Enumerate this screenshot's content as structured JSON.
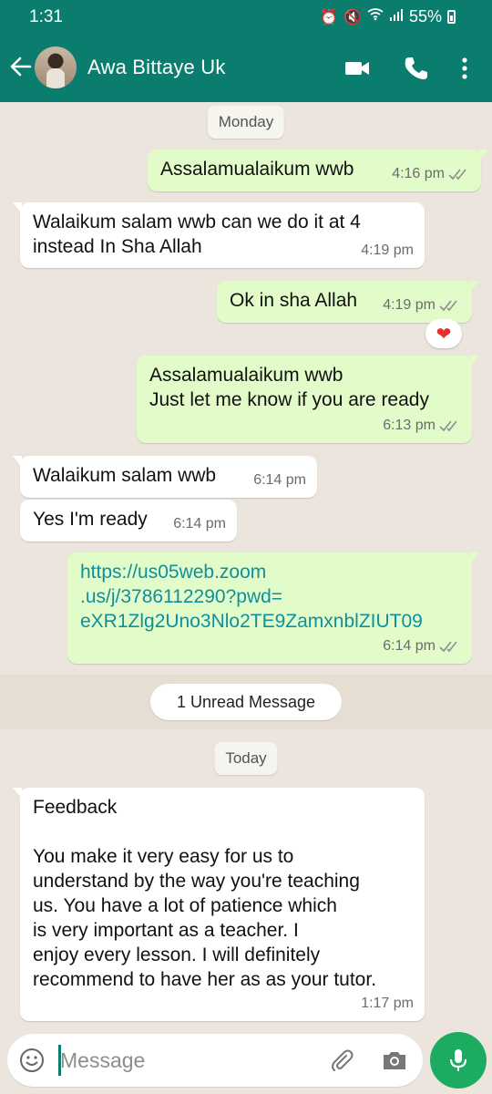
{
  "status_bar": {
    "time": "1:31",
    "battery": "55%"
  },
  "header": {
    "contact_name": "Awa Bittaye Uk"
  },
  "chat": {
    "date_monday": "Monday",
    "unread": "1 Unread Message",
    "date_today": "Today",
    "messages": [
      {
        "direction": "out",
        "lines": [
          "Assalamualaikum wwb"
        ],
        "time": "4:16 pm",
        "read": true
      },
      {
        "direction": "in",
        "lines": [
          "Walaikum salam wwb can we do it at 4",
          "instead In Sha Allah"
        ],
        "time": "4:19 pm"
      },
      {
        "direction": "out",
        "lines": [
          "Ok in sha Allah"
        ],
        "time": "4:19 pm",
        "read": true,
        "reaction": "❤"
      },
      {
        "direction": "out",
        "lines": [
          "Assalamualaikum wwb",
          "Just let me know if you are ready"
        ],
        "time": "6:13 pm",
        "read": true
      },
      {
        "direction": "in",
        "lines": [
          "Walaikum salam wwb"
        ],
        "time": "6:14 pm"
      },
      {
        "direction": "in",
        "lines": [
          "Yes I'm ready"
        ],
        "time": "6:14 pm"
      },
      {
        "direction": "out",
        "lines": [
          "https://us05web.zoom",
          ".us/j/3786112290?pwd=",
          "eXR1Zlg2Uno3Nlo2TE9ZamxnblZIUT09"
        ],
        "time": "6:14 pm",
        "read": true
      },
      {
        "direction": "in",
        "lines": [
          "Feedback",
          "",
          "You make it very easy for us to",
          "understand by the way you're teaching",
          "us. You have a lot of patience which",
          "is very important as a teacher. I",
          "enjoy every lesson. I will definitely",
          "recommend to have her as as your tutor."
        ],
        "time": "1:17 pm"
      }
    ]
  },
  "composer": {
    "placeholder": "Message"
  },
  "colors": {
    "header": "#0b7d6e",
    "outgoing_bubble": "#e2fcc9",
    "incoming_bubble": "#ffffff",
    "chat_bg": "#ece5dd",
    "mic_button": "#1daa61",
    "read_ticks": "#8e8e8e",
    "link": "#0f8f9d"
  },
  "icons": [
    "back-arrow-icon",
    "video-call-icon",
    "phone-icon",
    "more-vert-icon",
    "emoji-icon",
    "attach-icon",
    "camera-icon",
    "mic-icon",
    "double-check-icon",
    "heart-icon"
  ]
}
